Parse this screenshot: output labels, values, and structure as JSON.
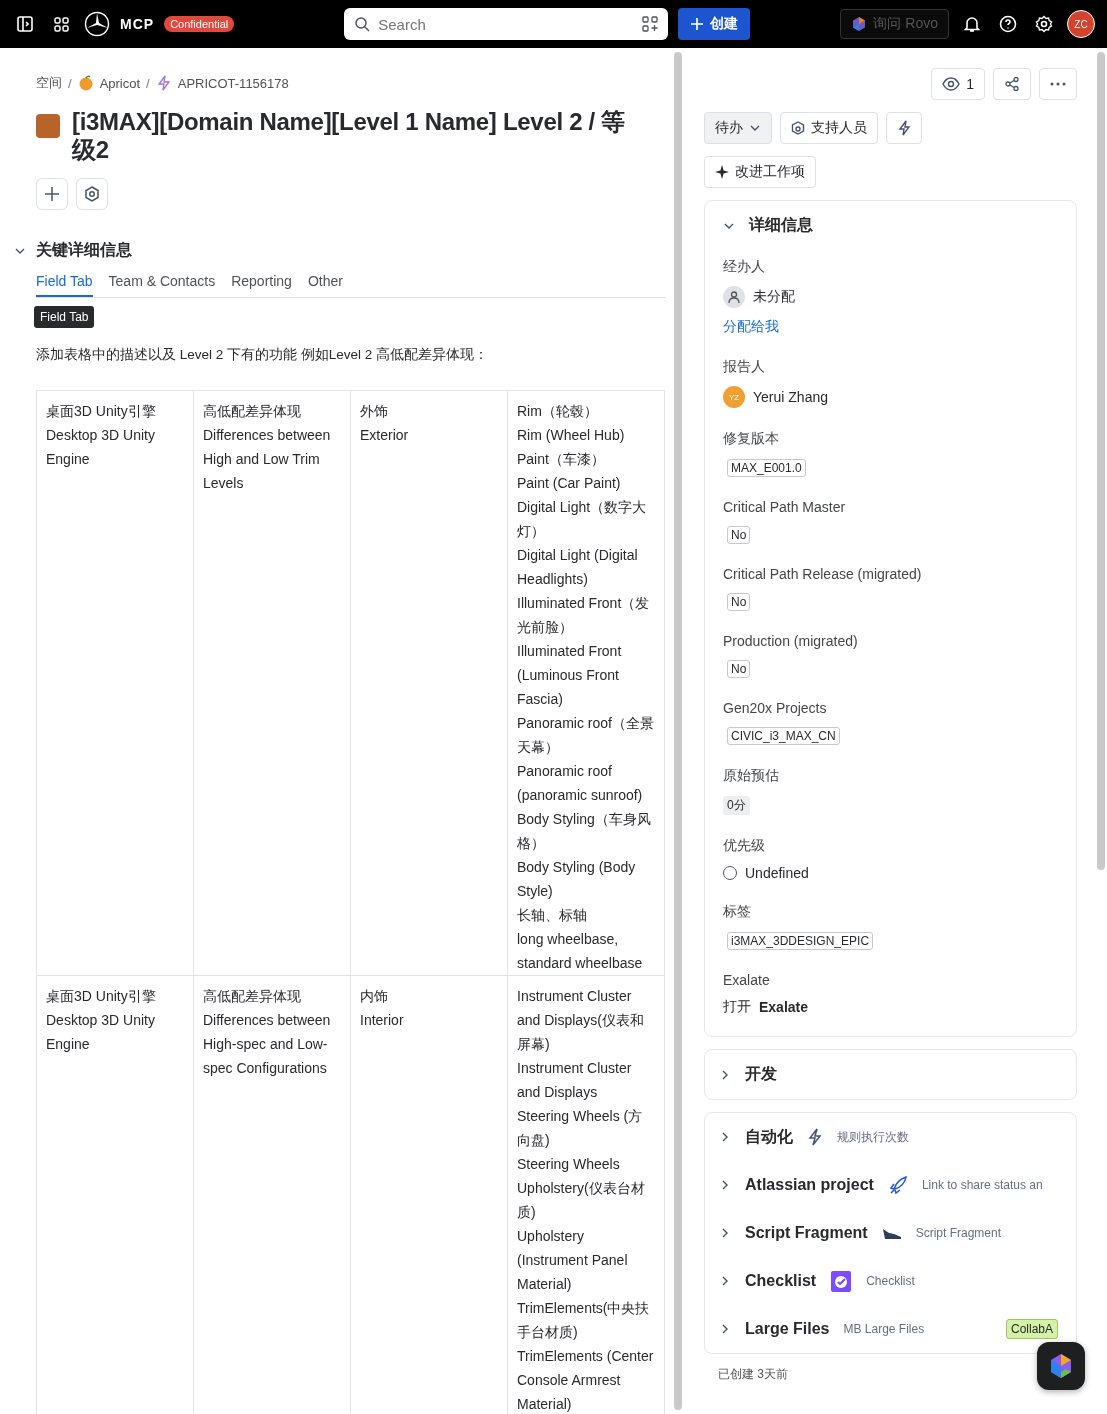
{
  "topbar": {
    "logo_text": "MCP",
    "badge": "Confidential",
    "search": {
      "placeholder": "Search"
    },
    "create_button": "创建",
    "rovo_button": {
      "label": "询问 Rovo",
      "disabled": true
    },
    "avatar": "ZC"
  },
  "breadcrumbs": [
    {
      "kind": "space",
      "label": "空间",
      "separator": "/"
    },
    {
      "kind": "project",
      "label": "Apricot",
      "separator": "/"
    },
    {
      "kind": "issue",
      "label": "APRICOT-1156178"
    }
  ],
  "title": "[i3MAX][Domain Name][Level 1 Name] Level 2 / 等级2",
  "section": {
    "title": "关键详细信息",
    "expanded": true
  },
  "tabs": [
    {
      "label": "Field Tab",
      "selected": true
    },
    {
      "label": "Team & Contacts",
      "selected": false
    },
    {
      "label": "Reporting",
      "selected": false
    },
    {
      "label": "Other",
      "selected": false
    }
  ],
  "tooltip": "Field Tab",
  "description": "添加表格中的描述以及 Level 2 下有的功能 例如Level 2 高低配差异体现：",
  "table": {
    "rows": [
      {
        "cells": [
          [
            "桌面3D Unity引擎",
            "Desktop 3D Unity Engine"
          ],
          [
            "高低配差异体现",
            "Differences between High and Low Trim Levels"
          ],
          [
            "外饰",
            "Exterior"
          ],
          [
            "Rim（轮毂）",
            "Rim (Wheel Hub)",
            "Paint（车漆）",
            "Paint (Car Paint)",
            "Digital Light（数字大灯）",
            "Digital Light (Digital Headlights)",
            "Illuminated Front（发光前脸）",
            "Illuminated Front (Luminous Front Fascia)",
            "Panoramic roof（全景天幕）",
            "Panoramic roof (panoramic sunroof)",
            "Body Styling（车身风格）",
            "Body Styling (Body Style)",
            "长轴、标轴",
            "long wheelbase, standard wheelbase"
          ]
        ]
      },
      {
        "cells": [
          [
            "桌面3D Unity引擎",
            "Desktop 3D Unity Engine"
          ],
          [
            "高低配差异体现",
            "Differences between High-spec and Low-spec Configurations"
          ],
          [
            "内饰",
            "Interior"
          ],
          [
            "Instrument Cluster and Displays(仪表和屏幕)",
            "Instrument Cluster and Displays",
            "Steering Wheels (方向盘)",
            "Steering Wheels",
            "Upholstery(仪表台材质)",
            "Upholstery (Instrument Panel Material)",
            "TrimElements(中央扶手台材质)",
            "TrimElements (Center Console Armrest Material)"
          ]
        ]
      }
    ]
  },
  "side": {
    "watchers": "1",
    "status_button": "待办",
    "support_button": "支持人员",
    "improve_button": "改进工作项",
    "details": {
      "title": "详细信息",
      "expanded": true,
      "fields": [
        {
          "label": "经办人",
          "kind": "assignee",
          "value": "未分配",
          "link": "分配给我"
        },
        {
          "label": "报告人",
          "kind": "person",
          "initials": "YZ",
          "value": "Yerui Zhang"
        },
        {
          "label": "修复版本",
          "kind": "tag",
          "value": "MAX_E001.0"
        },
        {
          "label": "Critical Path Master",
          "kind": "tag",
          "value": "No"
        },
        {
          "label": "Critical Path Release (migrated)",
          "kind": "tag",
          "value": "No"
        },
        {
          "label": "Production (migrated)",
          "kind": "tag",
          "value": "No"
        },
        {
          "label": "Gen20x Projects",
          "kind": "tag",
          "value": "CIVIC_i3_MAX_CN"
        },
        {
          "label": "原始预估",
          "kind": "lozenge",
          "value": "0分"
        },
        {
          "label": "优先级",
          "kind": "priority",
          "value": "Undefined"
        },
        {
          "label": "标签",
          "kind": "tag",
          "value": "i3MAX_3DDESIGN_EPIC"
        },
        {
          "label": "Exalate",
          "kind": "link",
          "value": "打开 **Exalate**"
        }
      ]
    },
    "panels": [
      {
        "title": "开发",
        "expanded": false
      }
    ],
    "apps": [
      {
        "kind": "automation",
        "title": "自动化",
        "caption": "规则执行次数",
        "expanded": false
      },
      {
        "kind": "project",
        "title": "Atlassian project",
        "caption": "Link to share status an",
        "expanded": false
      },
      {
        "kind": "fragment",
        "title": "Script Fragment",
        "caption": "Script Fragment",
        "expanded": false
      },
      {
        "kind": "checklist",
        "title": "Checklist",
        "caption": "Checklist",
        "expanded": false
      },
      {
        "kind": "files",
        "title": "Large Files",
        "caption": "MB Large Files",
        "badge": "CollabA",
        "expanded": false
      }
    ],
    "created": "已创建 3天前"
  }
}
